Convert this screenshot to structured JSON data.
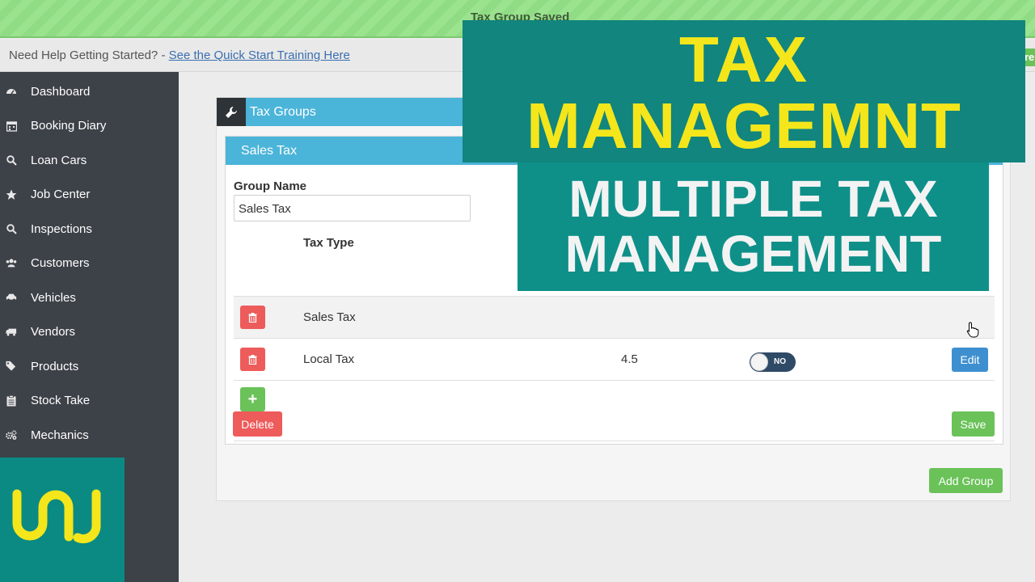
{
  "notification": {
    "message": "Tax Group Saved"
  },
  "help_bar": {
    "prefix": "Need Help Getting Started? - ",
    "link": "See the Quick Start Training Here",
    "right_fragment": "re"
  },
  "sidebar": {
    "items": [
      {
        "label": "Dashboard",
        "icon": "dashboard-icon"
      },
      {
        "label": "Booking Diary",
        "icon": "calendar-icon"
      },
      {
        "label": "Loan Cars",
        "icon": "search-icon"
      },
      {
        "label": "Job Center",
        "icon": "star-icon"
      },
      {
        "label": "Inspections",
        "icon": "search-icon"
      },
      {
        "label": "Customers",
        "icon": "users-icon"
      },
      {
        "label": "Vehicles",
        "icon": "car-icon"
      },
      {
        "label": "Vendors",
        "icon": "truck-icon"
      },
      {
        "label": "Products",
        "icon": "tags-icon"
      },
      {
        "label": "Stock Take",
        "icon": "clipboard-icon"
      },
      {
        "label": "Mechanics",
        "icon": "gears-icon"
      }
    ]
  },
  "panel": {
    "title": "Tax Groups",
    "card": {
      "title": "Sales Tax",
      "group_name_label": "Group Name",
      "group_name_value": "Sales Tax",
      "columns": {
        "tax_type": "Tax Type"
      },
      "rows": [
        {
          "name": "Sales Tax",
          "rate": "",
          "toggle": ""
        },
        {
          "name": "Local Tax",
          "rate": "4.5",
          "toggle": "NO",
          "edit_label": "Edit"
        }
      ],
      "add_label": "+",
      "delete_label": "Delete",
      "save_label": "Save"
    },
    "add_group_label": "Add Group"
  },
  "overlay": {
    "line1": "TAX",
    "line2": "MANAGEMNT",
    "line3": "MULTIPLE TAX",
    "line4": "MANAGEMENT"
  },
  "colors": {
    "success": "#9be38f",
    "sidebar": "#3d4148",
    "header_blue": "#4bb4d9",
    "danger": "#ee5b5b",
    "success_btn": "#6ac259",
    "edit_btn": "#3e8fd0",
    "overlay_teal": "#11857e",
    "overlay_yellow": "#f4e61b"
  }
}
